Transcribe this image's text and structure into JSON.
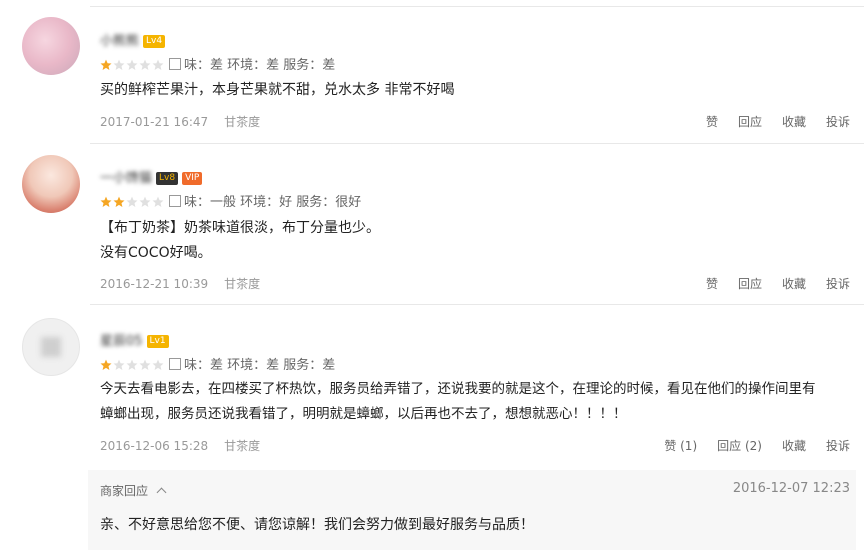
{
  "reviews": [
    {
      "username": "小熊熊",
      "level": "Lv4",
      "vip": "",
      "stars_filled": 1,
      "stars_total": 5,
      "scores": "味：差  环境：差  服务：差",
      "text_lines": [
        "买的鲜榨芒果汁，本身芒果就不甜，兑水太多 非常不好喝"
      ],
      "date": "2017-01-21 16:47",
      "shop": "甘茶度",
      "actions": [
        "赞",
        "回应",
        "收藏",
        "投诉"
      ]
    },
    {
      "username": "一小馋猫",
      "level": "Lv8",
      "vip": "VIP",
      "stars_filled": 2,
      "stars_total": 5,
      "scores": "味：一般  环境：好  服务：很好",
      "text_lines": [
        "【布丁奶茶】奶茶味道很淡，布丁分量也少。",
        "没有COCO好喝。"
      ],
      "date": "2016-12-21 10:39",
      "shop": "甘茶度",
      "actions": [
        "赞",
        "回应",
        "收藏",
        "投诉"
      ]
    },
    {
      "username": "星辰05",
      "level": "Lv1",
      "vip": "",
      "stars_filled": 1,
      "stars_total": 5,
      "scores": "味：差  环境：差  服务：差",
      "text_lines": [
        "今天去看电影去，在四楼买了杯热饮，服务员给弄错了，还说我要的就是这个，在理论的时候，看见在他们的操作间里有",
        "蟑螂出现，服务员还说我看错了，明明就是蟑螂，以后再也不去了，想想就恶心！！！！"
      ],
      "date": "2016-12-06 15:28",
      "shop": "甘茶度",
      "actions": [
        "赞 (1)",
        "回应 (2)",
        "收藏",
        "投诉"
      ]
    }
  ],
  "merchant_reply": {
    "label": "商家回应",
    "date": "2016-12-07 12:23",
    "text": "亲、不好意思给您不便、请您谅解！我们会努力做到最好服务与品质！"
  },
  "colors": {
    "star_filled": "#f5a623",
    "star_empty": "#e0e0e0",
    "level_badge": "#f5b400",
    "vip_badge": "#f06b2b"
  }
}
